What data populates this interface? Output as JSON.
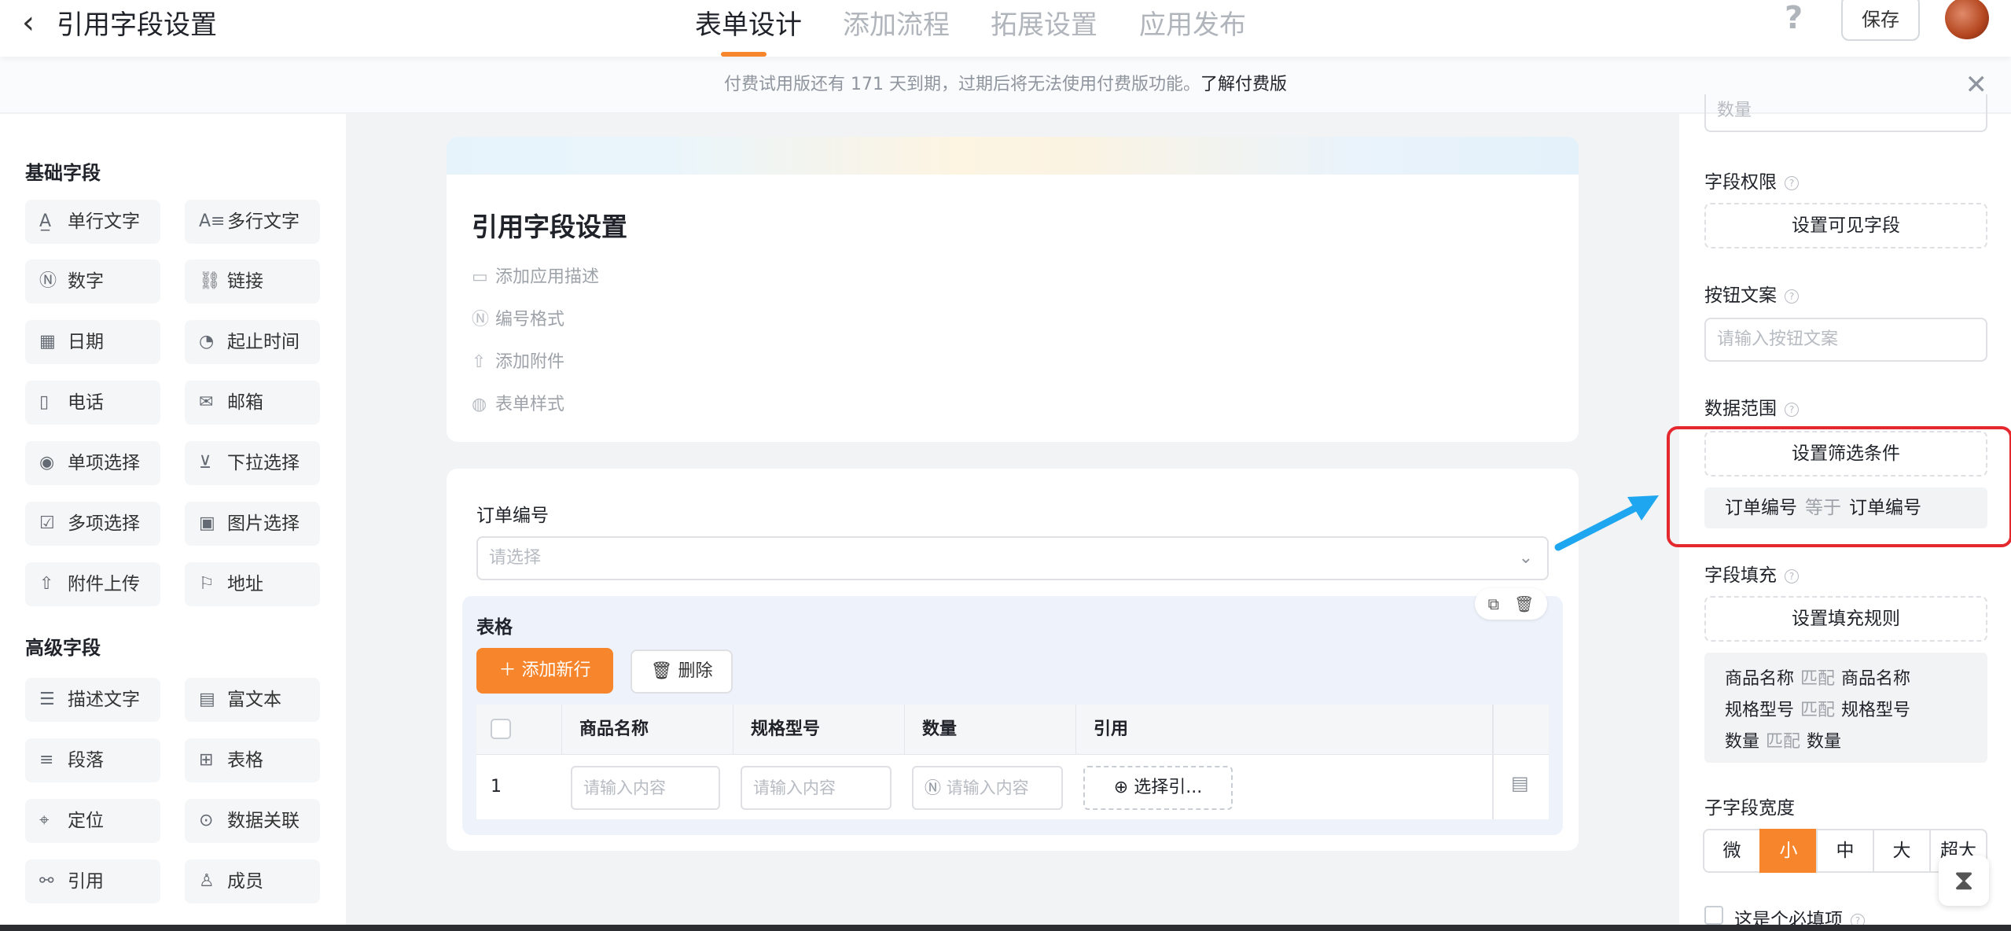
{
  "header": {
    "back_icon": "‹",
    "title": "引用字段设置",
    "tabs": [
      "表单设计",
      "添加流程",
      "拓展设置",
      "应用发布"
    ],
    "help": "?",
    "save": "保存"
  },
  "notice": {
    "text": "付费试用版还有 171 天到期，过期后将无法使用付费版功能。",
    "link": "了解付费版",
    "close": "✕"
  },
  "left": {
    "basic_title": "基础字段",
    "basic": [
      "单行文字",
      "多行文字",
      "数字",
      "链接",
      "日期",
      "起止时间",
      "电话",
      "邮箱",
      "单项选择",
      "下拉选择",
      "多项选择",
      "图片选择",
      "附件上传",
      "地址"
    ],
    "advanced_title": "高级字段",
    "advanced": [
      "描述文字",
      "富文本",
      "段落",
      "表格",
      "定位",
      "数据关联",
      "引用",
      "成员"
    ]
  },
  "form": {
    "title": "引用字段设置",
    "meta": [
      "添加应用描述",
      "编号格式",
      "添加附件",
      "表单样式"
    ]
  },
  "field": {
    "label": "订单编号",
    "placeholder": "请选择"
  },
  "table": {
    "label": "表格",
    "add_row": "添加新行",
    "delete": "删除",
    "columns": [
      "商品名称",
      "规格型号",
      "数量",
      "引用"
    ],
    "row": {
      "index": "1",
      "placeholder": "请输入内容",
      "select": "选择引..."
    }
  },
  "right": {
    "partial_top": "数量",
    "perm_label": "字段权限",
    "perm_btn": "设置可见字段",
    "btn_text_label": "按钮文案",
    "btn_text_placeholder": "请输入按钮文案",
    "range_label": "数据范围",
    "range_btn": "设置筛选条件",
    "cond": {
      "left": "订单编号",
      "op": "等于",
      "right": "订单编号"
    },
    "fill_label": "字段填充",
    "fill_btn": "设置填充规则",
    "fill_rules": [
      {
        "a": "商品名称",
        "op": "匹配",
        "b": "商品名称"
      },
      {
        "a": "规格型号",
        "op": "匹配",
        "b": "规格型号"
      },
      {
        "a": "数量",
        "op": "匹配",
        "b": "数量"
      }
    ],
    "width_label": "子字段宽度",
    "width_opts": [
      "微",
      "小",
      "中",
      "大",
      "超大"
    ],
    "required_label": "这是个必填项"
  },
  "colors": {
    "accent": "#f7852b",
    "highlight": "#e5282e",
    "arrow": "#1ea7f0"
  }
}
